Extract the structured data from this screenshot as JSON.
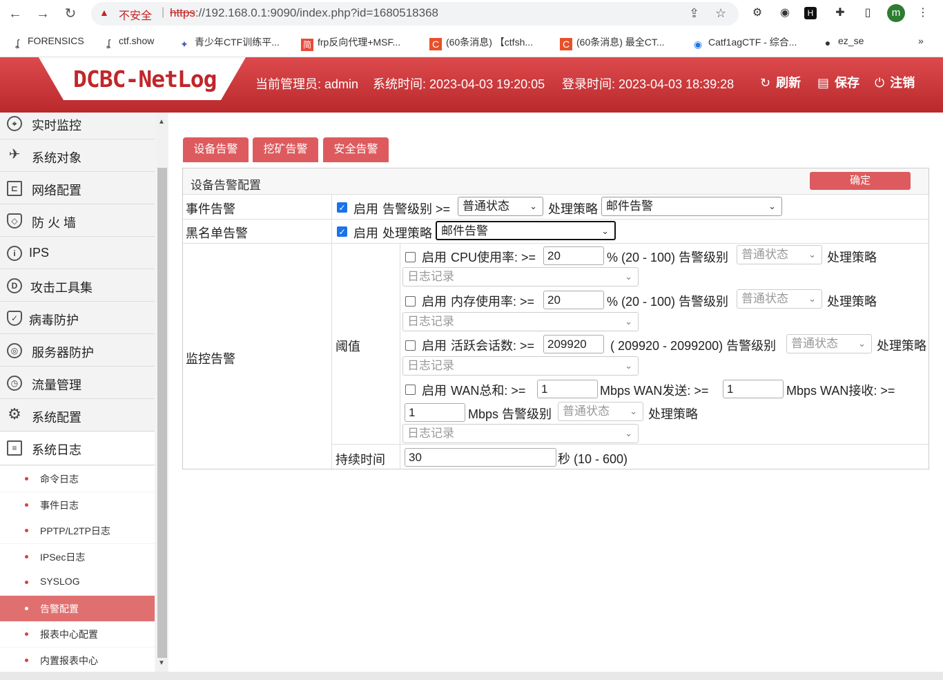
{
  "browser": {
    "warning_label": "不安全",
    "url_protocol": "https",
    "url_rest": "://192.168.0.1:9090/index.php?id=1680518368",
    "avatar_letter": "m",
    "bookmarks": [
      {
        "label": "FORENSICS"
      },
      {
        "label": "ctf.show"
      },
      {
        "label": "青少年CTF训练平..."
      },
      {
        "label": "frp反向代理+MSF..."
      },
      {
        "label": "(60条消息) 【ctfsh..."
      },
      {
        "label": "(60条消息) 最全CT..."
      },
      {
        "label": "Catf1agCTF - 综合..."
      },
      {
        "label": "ez_se"
      }
    ],
    "bookmark_more": "»"
  },
  "header": {
    "logo": "DCBC-NetLog",
    "admin": "当前管理员: admin",
    "system_time": "系统时间: 2023-04-03 19:20:05",
    "login_time": "登录时间: 2023-04-03 18:39:28",
    "refresh": "刷新",
    "save": "保存",
    "logout": "注销"
  },
  "sidebar": {
    "items": [
      {
        "label": "实时监控",
        "icon": "location-pin-icon"
      },
      {
        "label": "系统对象",
        "icon": "paper-plane-icon"
      },
      {
        "label": "网络配置",
        "icon": "network-icon"
      },
      {
        "label": "防 火 墙",
        "icon": "shield-icon"
      },
      {
        "label": "IPS",
        "icon": "info-icon"
      },
      {
        "label": "攻击工具集",
        "icon": "d-circle-icon"
      },
      {
        "label": "病毒防护",
        "icon": "shield-check-icon"
      },
      {
        "label": "服务器防护",
        "icon": "target-icon"
      },
      {
        "label": "流量管理",
        "icon": "clock-icon"
      },
      {
        "label": "系统配置",
        "icon": "gear-icon"
      },
      {
        "label": "系统日志",
        "icon": "log-icon"
      }
    ],
    "sub_items": [
      {
        "label": "命令日志"
      },
      {
        "label": "事件日志"
      },
      {
        "label": "PPTP/L2TP日志"
      },
      {
        "label": "IPSec日志"
      },
      {
        "label": "SYSLOG"
      },
      {
        "label": "告警配置"
      },
      {
        "label": "报表中心配置"
      },
      {
        "label": "内置报表中心"
      }
    ]
  },
  "tabs": [
    {
      "label": "设备告警"
    },
    {
      "label": "挖矿告警"
    },
    {
      "label": "安全告警"
    }
  ],
  "panel": {
    "title": "设备告警配置",
    "confirm": "确定",
    "event_alarm": {
      "label": "事件告警",
      "enable": "启用",
      "level_label": "告警级别 >=",
      "level_value": "普通状态",
      "policy_label": "处理策略",
      "policy_value": "邮件告警"
    },
    "blacklist_alarm": {
      "label": "黑名单告警",
      "enable": "启用",
      "policy_label": "处理策略",
      "policy_value": "邮件告警"
    },
    "monitor_alarm": {
      "label": "监控告警",
      "threshold_label": "阈值",
      "cpu": {
        "enable": "启用",
        "label": "CPU使用率: >=",
        "value": "20",
        "range": "% (20 - 100) 告警级别",
        "level_value": "普通状态",
        "policy_label": "处理策略",
        "policy_value": "日志记录"
      },
      "mem": {
        "enable": "启用",
        "label": "内存使用率: >=",
        "value": "20",
        "range": "% (20 - 100) 告警级别",
        "level_value": "普通状态",
        "policy_label": "处理策略",
        "policy_value": "日志记录"
      },
      "session": {
        "enable": "启用",
        "label": "活跃会话数: >=",
        "value": "209920",
        "range": "( 209920 - 2099200) 告警级别",
        "level_value": "普通状态",
        "policy_label": "处理策略",
        "policy_value": "日志记录"
      },
      "wan": {
        "enable": "启用",
        "label": "WAN总和: >=",
        "value": "1",
        "send_label": "Mbps WAN发送: >=",
        "send_value": "1",
        "recv_label": "Mbps WAN接收: >=",
        "recv_value": "1",
        "level_label": "Mbps 告警级别",
        "level_value": "普通状态",
        "policy_label": "处理策略",
        "policy_value": "日志记录"
      },
      "duration_label": "持续时间",
      "duration_value": "30",
      "duration_range": "秒 (10 - 600)"
    }
  }
}
